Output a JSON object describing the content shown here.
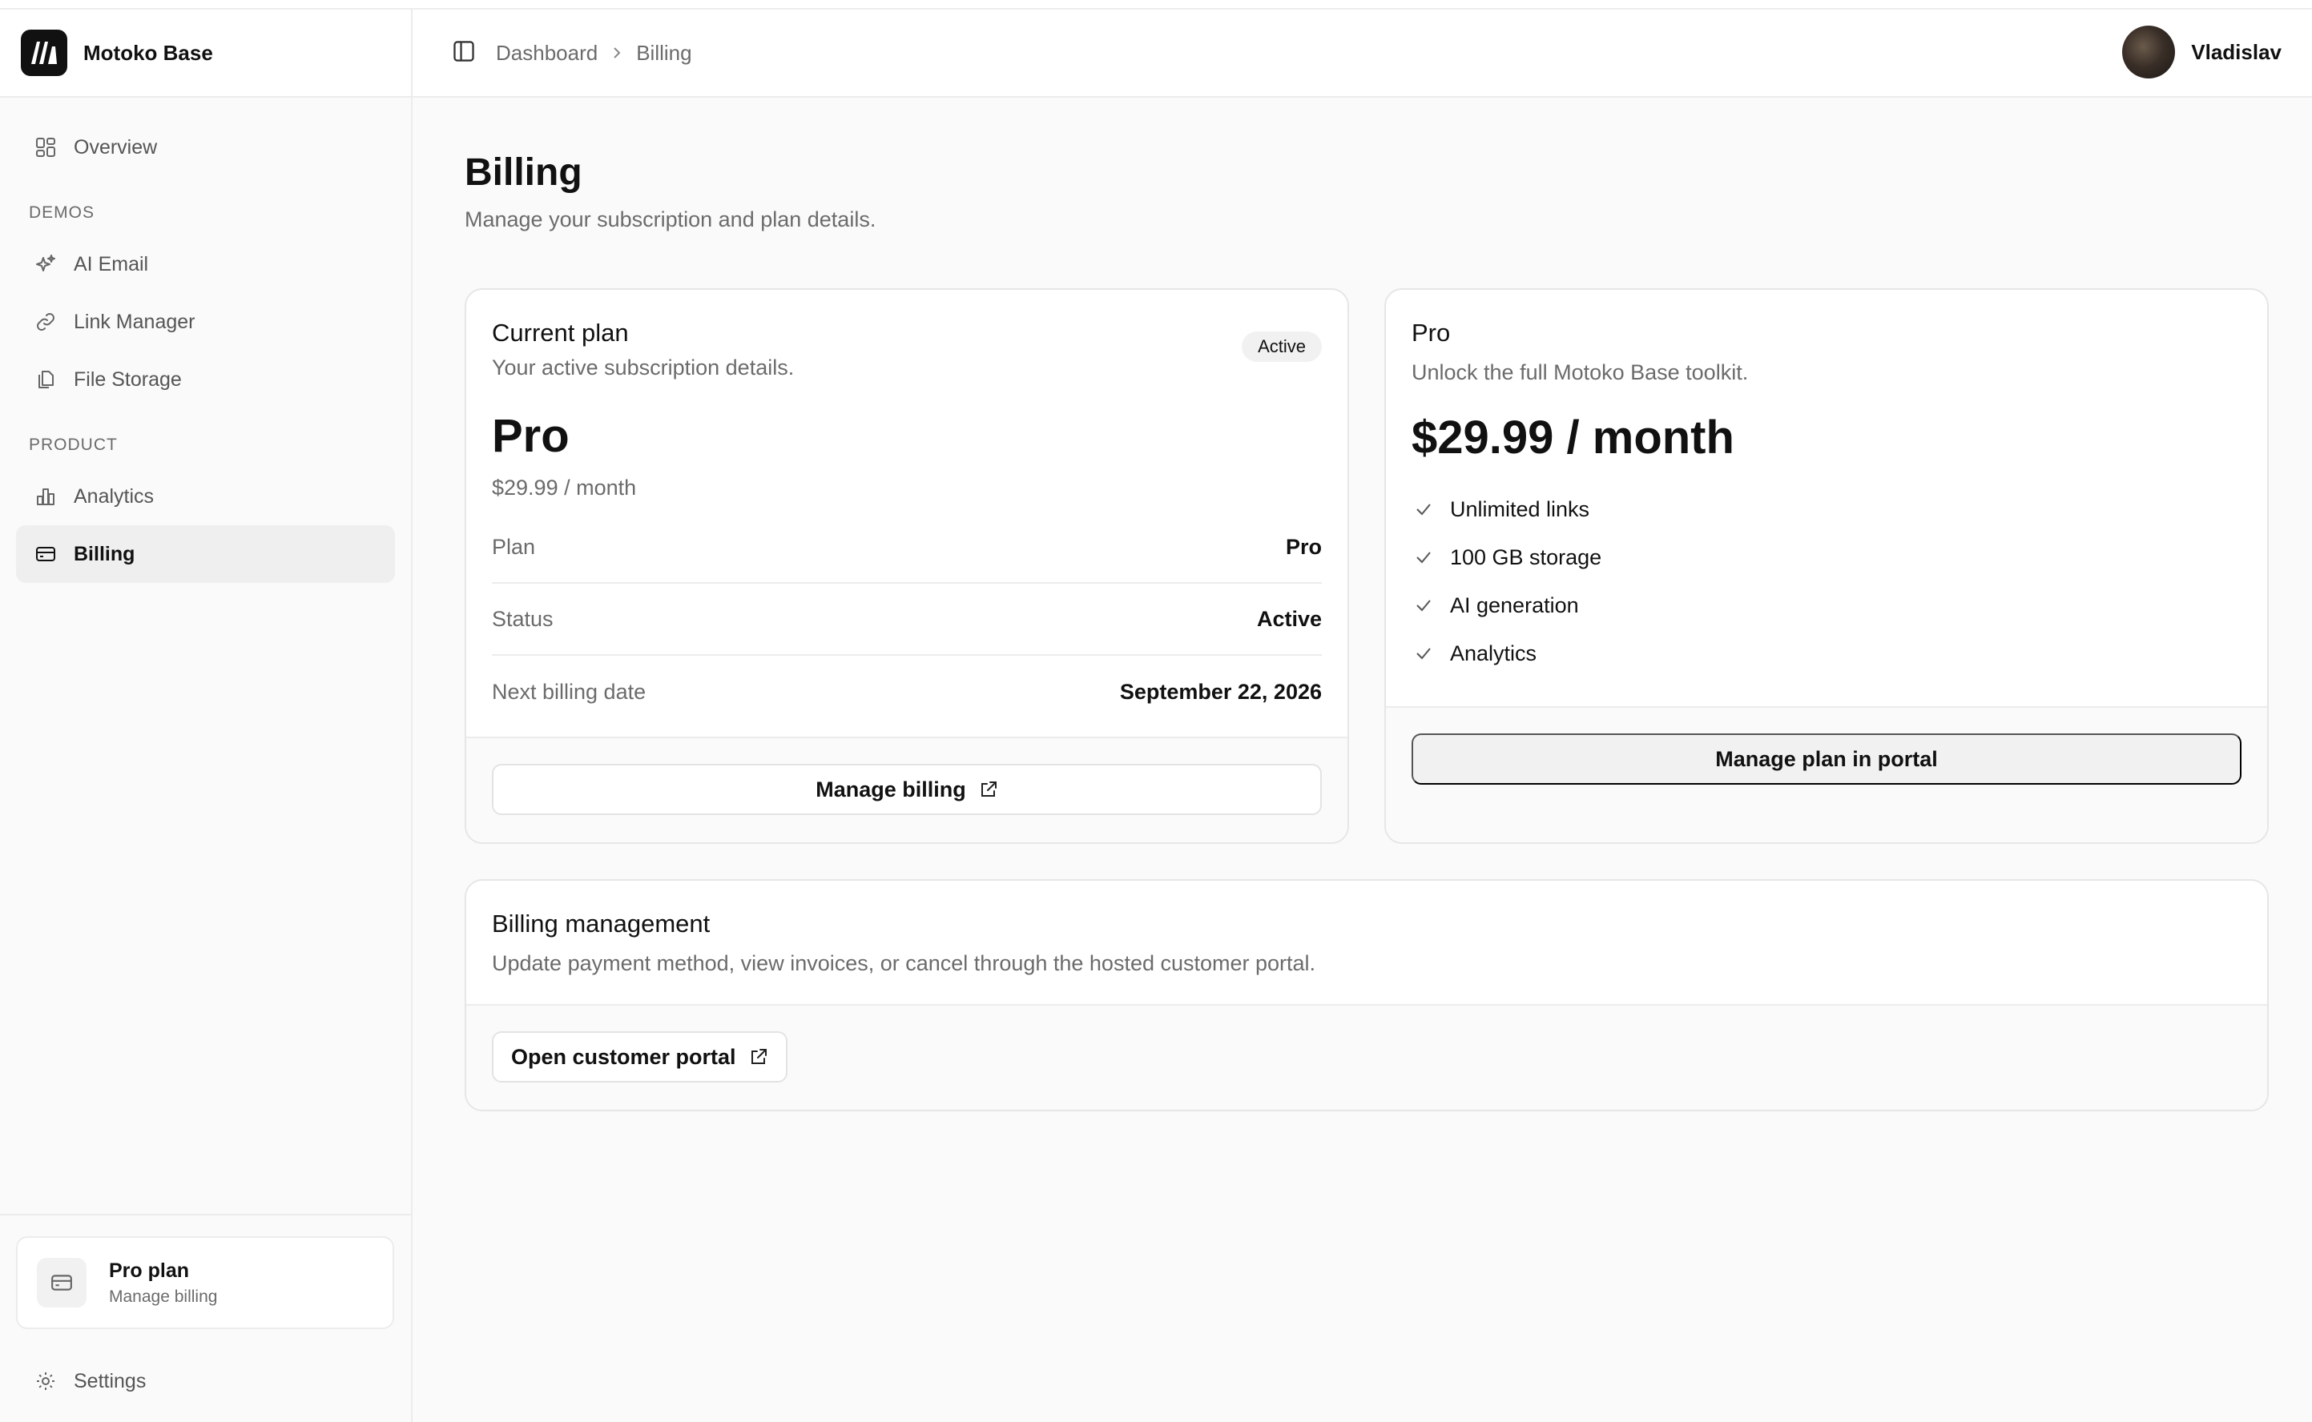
{
  "brand": {
    "name": "Motoko Base"
  },
  "sidebar": {
    "overview": "Overview",
    "sections": [
      {
        "label": "DEMOS",
        "items": [
          "AI Email",
          "Link Manager",
          "File Storage"
        ]
      },
      {
        "label": "PRODUCT",
        "items": [
          "Analytics",
          "Billing"
        ]
      }
    ],
    "active_item": "Billing",
    "plan_card": {
      "title": "Pro plan",
      "subtitle": "Manage billing"
    },
    "settings": "Settings"
  },
  "header": {
    "breadcrumb": [
      "Dashboard",
      "Billing"
    ],
    "user": {
      "name": "Vladislav"
    }
  },
  "page": {
    "title": "Billing",
    "subtitle": "Manage your subscription and plan details."
  },
  "current_plan": {
    "title": "Current plan",
    "subtitle": "Your active subscription details.",
    "badge": "Active",
    "plan_name": "Pro",
    "price": "$29.99 / month",
    "rows": [
      {
        "label": "Plan",
        "value": "Pro"
      },
      {
        "label": "Status",
        "value": "Active"
      },
      {
        "label": "Next billing date",
        "value": "September 22, 2026"
      }
    ],
    "button": "Manage billing"
  },
  "pro_plan": {
    "title": "Pro",
    "subtitle": "Unlock the full Motoko Base toolkit.",
    "price": "$29.99 / month",
    "features": [
      "Unlimited links",
      "100 GB storage",
      "AI generation",
      "Analytics"
    ],
    "button": "Manage plan in portal"
  },
  "billing_management": {
    "title": "Billing management",
    "subtitle": "Update payment method, view invoices, or cancel through the hosted customer portal.",
    "button": "Open customer portal"
  }
}
